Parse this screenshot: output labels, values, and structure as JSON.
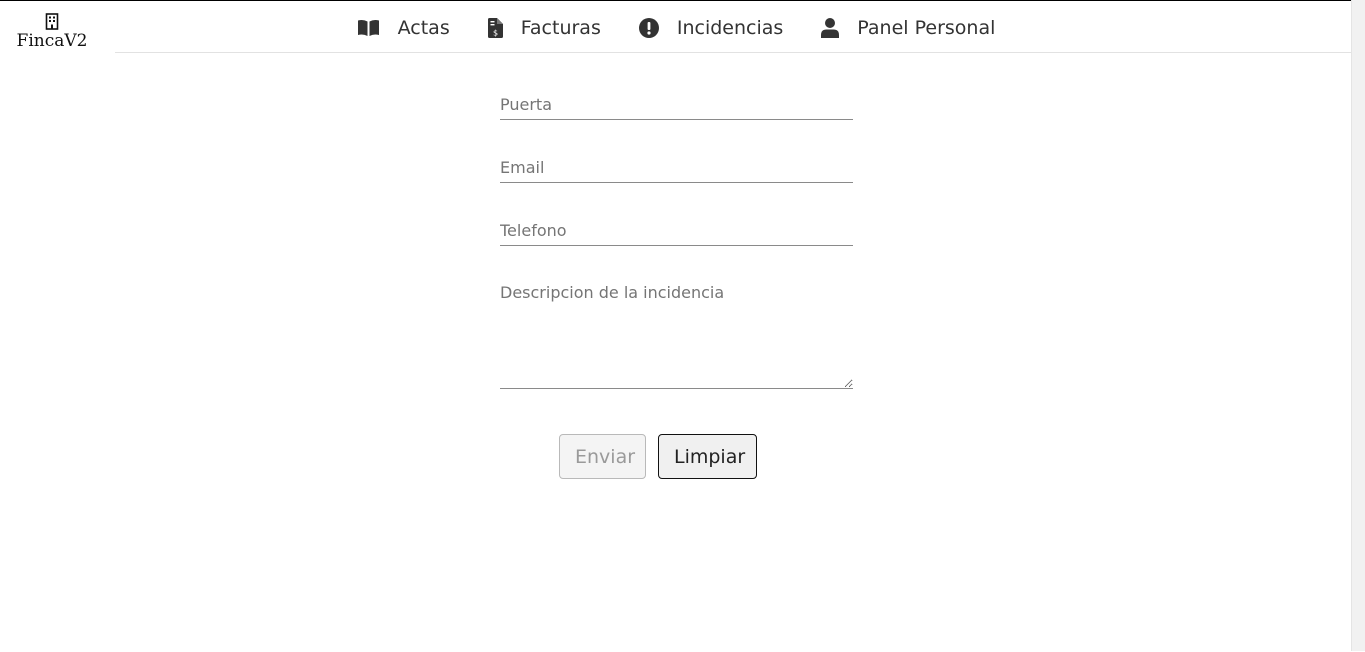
{
  "brand": {
    "name": "FincaV2",
    "icon": "building-icon"
  },
  "nav": {
    "items": [
      {
        "label": "Actas",
        "icon": "book-open-icon"
      },
      {
        "label": "Facturas",
        "icon": "file-invoice-dollar-icon"
      },
      {
        "label": "Incidencias",
        "icon": "exclamation-circle-icon"
      },
      {
        "label": "Panel Personal",
        "icon": "user-icon"
      }
    ]
  },
  "form": {
    "door_placeholder": "Puerta",
    "door_value": "",
    "email_placeholder": "Email",
    "email_value": "",
    "phone_placeholder": "Telefono",
    "phone_value": "",
    "description_placeholder": "Descripcion de la incidencia",
    "description_value": "",
    "send_label": "Enviar",
    "clear_label": "Limpiar"
  },
  "colors": {
    "text": "#333333",
    "placeholder": "#757575",
    "underline": "#8a8a8a",
    "disabled_text": "#9a9a9a"
  }
}
